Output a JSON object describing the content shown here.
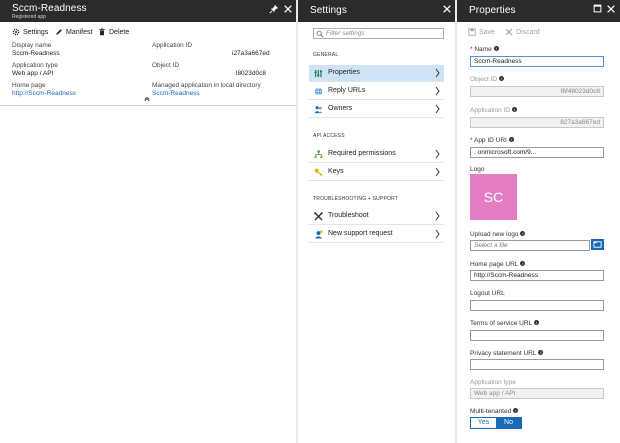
{
  "app_blade": {
    "title": "Sccm-Readness",
    "subtitle": "Registered app",
    "toolbar": {
      "settings": "Settings",
      "manifest": "Manifest",
      "delete": "Delete"
    },
    "essentials": {
      "display_name_label": "Display name",
      "display_name_value": "Sccm-Readness",
      "app_type_label": "Application type",
      "app_type_value": "Web app / API",
      "home_page_label": "Home page",
      "home_page_value": "http://Sccm-Readness",
      "app_id_label": "Application ID",
      "app_id_value": "i27a3a667ed",
      "object_id_label": "Object ID",
      "object_id_value": "l8023d0c8",
      "managed_label": "Managed application in local directory",
      "managed_value": "Sccm-Readness"
    }
  },
  "settings_blade": {
    "title": "Settings",
    "filter_placeholder": "Filter settings",
    "sections": {
      "general": "GENERAL",
      "api_access": "API ACCESS",
      "troubleshooting": "TROUBLESHOOTING + SUPPORT"
    },
    "items": {
      "properties": "Properties",
      "reply_urls": "Reply URLs",
      "owners": "Owners",
      "required_permissions": "Required permissions",
      "keys": "Keys",
      "troubleshoot": "Troubleshoot",
      "new_support_request": "New support request"
    }
  },
  "properties_blade": {
    "title": "Properties",
    "save": "Save",
    "discard": "Discard",
    "name_label": "Name",
    "name_value": "Sccm-Readness",
    "object_id_label": "Object ID",
    "object_id_value": "f6f48023d0c8",
    "app_id_label": "Application ID",
    "app_id_value": "827a3a667ed",
    "app_id_uri_label": "App ID URI",
    "app_id_uri_value": ".                        onmicrosoft.com/9...",
    "logo_label": "Logo",
    "logo_initials": "SC",
    "upload_label": "Upload new logo",
    "upload_placeholder": "Select a file",
    "home_page_label": "Home page URL",
    "home_page_value": "http://Sccm-Readness",
    "logout_label": "Logout URL",
    "logout_value": "",
    "terms_label": "Terms of service URL",
    "terms_value": "",
    "privacy_label": "Privacy statement URL",
    "privacy_value": "",
    "app_type_label": "Application type",
    "app_type_value": "Web app / API",
    "multi_tenant_label": "Multi-tenanted",
    "yes": "Yes",
    "no": "No"
  },
  "colors": {
    "header": "#2b2b2b",
    "accent": "#1a68b8",
    "active_row": "#cfe3f6",
    "logo": "#e57dc4",
    "required": "#d10000"
  },
  "icons": [
    "pin-icon",
    "close-icon",
    "gear-icon",
    "pencil-icon",
    "trash-icon",
    "maximize-icon",
    "search-icon",
    "properties-icon",
    "globe-icon",
    "owners-icon",
    "permissions-icon",
    "key-icon",
    "wrench-icon",
    "support-icon",
    "save-icon",
    "discard-icon",
    "folder-icon",
    "chevron-right-icon",
    "chevron-up-icon"
  ]
}
